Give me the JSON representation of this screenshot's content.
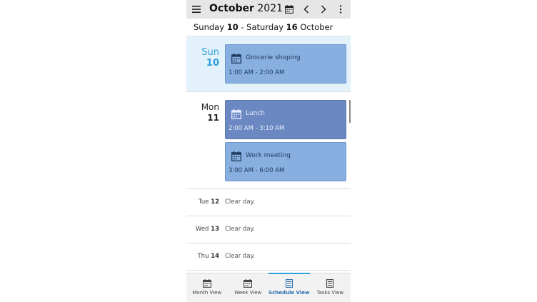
{
  "header": {
    "month": "October",
    "year": "2021"
  },
  "range": {
    "start_day": "Sunday",
    "start_num": "10",
    "separator": "-",
    "end_day": "Saturday",
    "end_num": "16",
    "month": "October"
  },
  "days": [
    {
      "name": "Sun",
      "num": "10",
      "events": [
        {
          "title": "Grocerie shoping",
          "time": "1:00 AM - 2:00 AM",
          "color": "#87afe0",
          "text_color": "#1f3a5c"
        }
      ]
    },
    {
      "name": "Mon",
      "num": "11",
      "events": [
        {
          "title": "Lunch",
          "time": "2:00 AM - 3:10 AM",
          "color": "#6b88c2",
          "text_color": "#e8eefb"
        },
        {
          "title": "Work meeting",
          "time": "3:00 AM - 6:00 AM",
          "color": "#87afe0",
          "text_color": "#1f3a5c"
        }
      ]
    }
  ],
  "clear_days": [
    {
      "name": "Tue",
      "num": "12",
      "text": "Clear day."
    },
    {
      "name": "Wed",
      "num": "13",
      "text": "Clear day."
    },
    {
      "name": "Thu",
      "num": "14",
      "text": "Clear day."
    }
  ],
  "nav": [
    {
      "label": "Month View",
      "active": false
    },
    {
      "label": "Week View",
      "active": false
    },
    {
      "label": "Schedule View",
      "active": true
    },
    {
      "label": "Tasks View",
      "active": false
    }
  ],
  "colors": {
    "accent": "#2e9fd8",
    "today_bg": "#e3f1fb"
  },
  "icons": {
    "menu": "hamburger-icon",
    "calendar": "calendar-icon",
    "prev": "chevron-left-icon",
    "next": "chevron-right-icon",
    "more": "more-vertical-icon",
    "event": "calendar-icon",
    "tasks": "list-icon"
  }
}
